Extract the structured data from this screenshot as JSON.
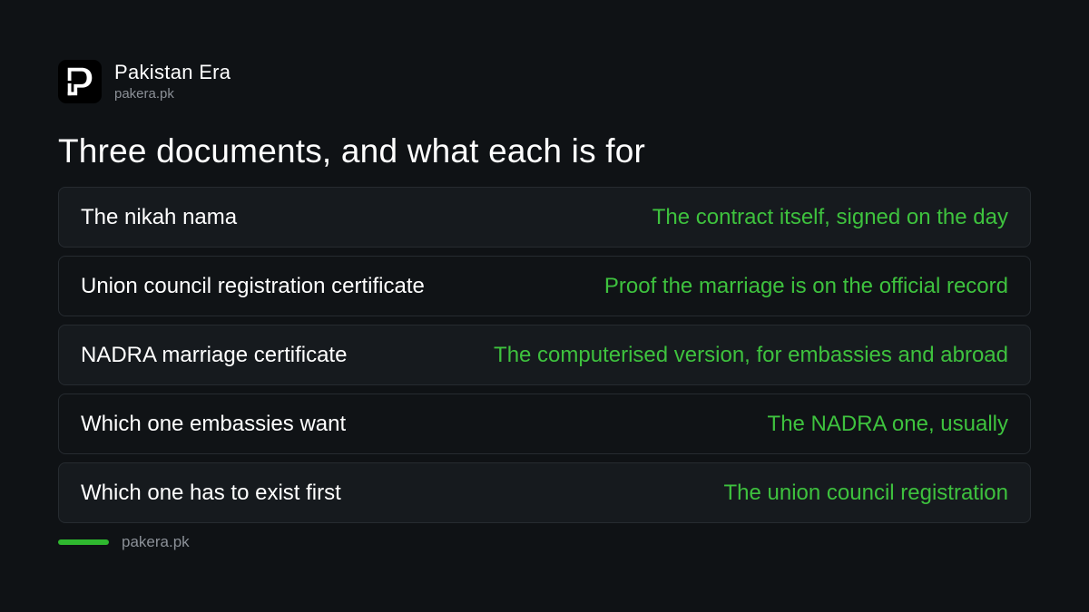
{
  "brand": {
    "name": "Pakistan Era",
    "url": "pakera.pk"
  },
  "headline": "Three documents, and what each is for",
  "rows": [
    {
      "label": "The nikah nama",
      "value": "The contract itself, signed on the day"
    },
    {
      "label": "Union council registration certificate",
      "value": "Proof the marriage is on the official record"
    },
    {
      "label": "NADRA marriage certificate",
      "value": "The computerised version, for embassies and abroad"
    },
    {
      "label": "Which one embassies want",
      "value": "The NADRA one, usually"
    },
    {
      "label": "Which one has to exist first",
      "value": "The union council registration"
    }
  ],
  "footer": {
    "url": "pakera.pk"
  },
  "colors": {
    "background": "#0f1215",
    "accent": "#3ec23e",
    "row_background": "#161a1e",
    "muted_text": "#8b9097"
  },
  "icons": {
    "logo": "pakistan-era-logo-icon"
  }
}
